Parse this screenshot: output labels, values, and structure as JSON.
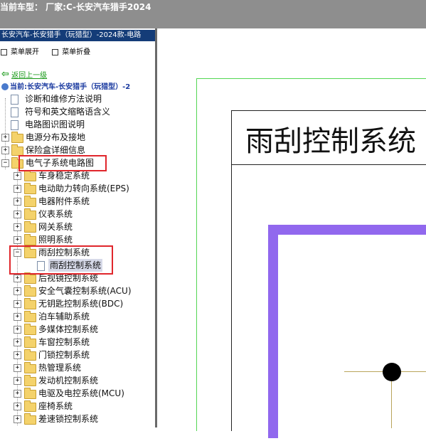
{
  "topbar": {
    "text": "当前车型： 厂家:C-长安汽车猎手2024"
  },
  "panel": {
    "title": "长安汽车-长安猎手（玩猎型）-2024款-电路",
    "expand_label": "菜单展开",
    "collapse_label": "菜单折叠",
    "back_label": "返回上一级",
    "current_label": "当前:长安汽车-长安猎手（玩猎型）-2"
  },
  "tree": {
    "top_items": [
      {
        "label": "诊断和维修方法说明",
        "type": "doc"
      },
      {
        "label": "符号和英文缩略语含义",
        "type": "doc"
      },
      {
        "label": "电路图识图说明",
        "type": "doc"
      },
      {
        "label": "电源分布及接地",
        "type": "folder"
      },
      {
        "label": "保险盒详细信息",
        "type": "folder"
      },
      {
        "label": "电气子系统电路图",
        "type": "folder-open"
      }
    ],
    "sub_items": [
      "车身稳定系统",
      "电动助力转向系统(EPS)",
      "电器附件系统",
      "仪表系统",
      "网关系统",
      "照明系统",
      "雨刮控制系统",
      "雨刮控制系统",
      "后视镜控制系统",
      "安全气囊控制系统(ACU)",
      "无钥匙控制系统(BDC)",
      "泊车辅助系统",
      "多媒体控制系统",
      "车窗控制系统",
      "门锁控制系统",
      "热管理系统",
      "发动机控制系统",
      "电驱及电控系统(MCU)",
      "座椅系统",
      "差速锁控制系统"
    ]
  },
  "diagram": {
    "title": "雨刮控制系统",
    "accent_color": "#9168ee",
    "frame_color": "#53d653"
  }
}
